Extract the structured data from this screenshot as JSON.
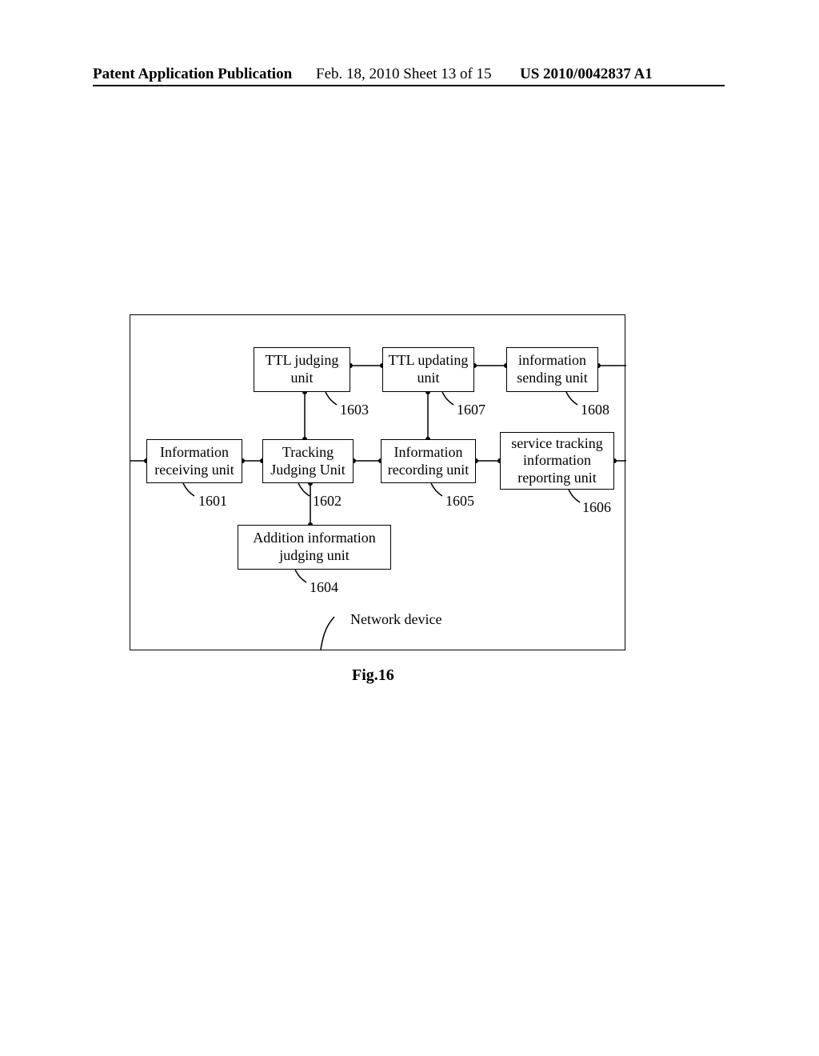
{
  "header": {
    "left": "Patent Application Publication",
    "middle": "Feb. 18, 2010  Sheet 13 of 15",
    "right": "US 2010/0042837 A1"
  },
  "boxes": {
    "b1603": "TTL judging unit",
    "b1607": "TTL updating unit",
    "b1608": "information sending unit",
    "b1601": "Information receiving unit",
    "b1602": "Tracking Judging Unit",
    "b1605": "Information recording unit",
    "b1606": "service tracking information reporting unit",
    "b1604": "Addition information judging unit"
  },
  "refs": {
    "r1603": "1603",
    "r1607": "1607",
    "r1608": "1608",
    "r1601": "1601",
    "r1602": "1602",
    "r1605": "1605",
    "r1606": "1606",
    "r1604": "1604"
  },
  "container_label": "Network device",
  "figure_caption": "Fig.16"
}
